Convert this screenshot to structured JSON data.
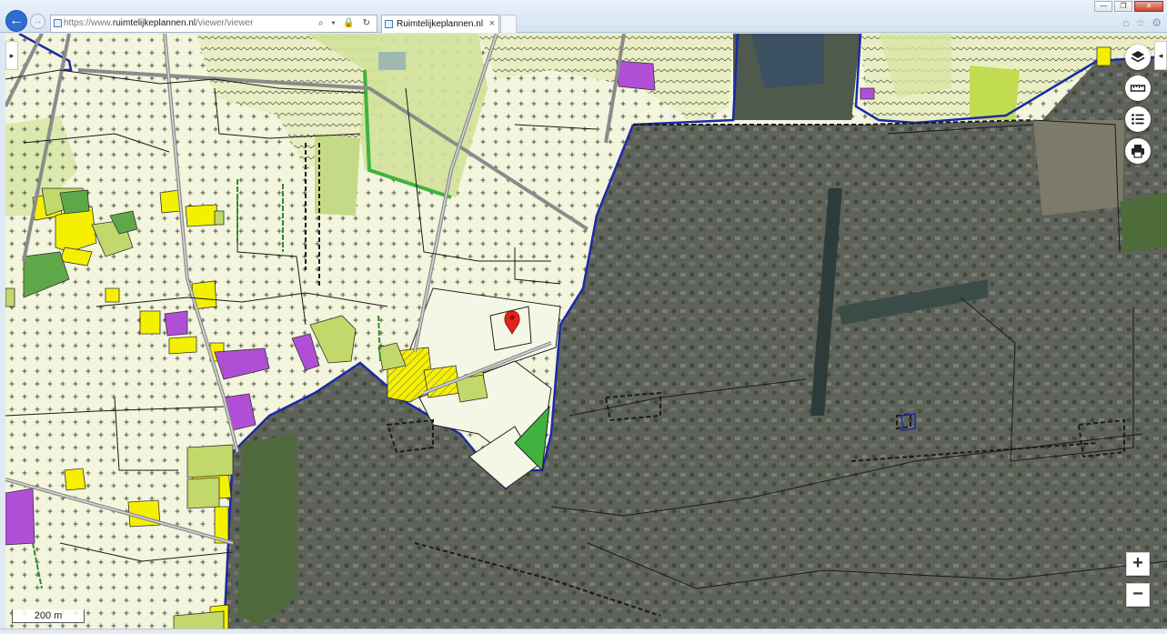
{
  "browser": {
    "url_prefix": "https://www.",
    "url_domain": "ruimtelijkeplannen.nl",
    "url_path": "/viewer/viewer",
    "tab_title": "Ruimtelijkeplannen.nl",
    "tab_close": "×",
    "addr_tools": "⌕ ▾ 🔒 ↻",
    "back_symbol": "←",
    "forward_symbol": "→",
    "window_controls": {
      "minimize": "—",
      "maximize": "❐",
      "close": "✕"
    },
    "toolbar_icons": [
      "home-icon",
      "favorites-star-icon",
      "settings-gear-icon"
    ],
    "toolbar_glyphs": {
      "home": "⌂",
      "favorites": "☆",
      "settings": "⚙"
    }
  },
  "map": {
    "left_panel_toggle": "▸",
    "right_panel_toggle": "◂",
    "tools": [
      "layers-icon",
      "measure-ruler-icon",
      "legend-list-icon",
      "print-icon"
    ],
    "zoom_in": "+",
    "zoom_out": "−",
    "scale_label": "200 m",
    "colors": {
      "agrarisch": "#f3f5dc",
      "natuur_light": "#d7e6a4",
      "natuur": "#bdd476",
      "groen": "#3fb23f",
      "wonen_yellow": "#f5f000",
      "bedrijf_purple": "#b04fd6",
      "plan_boundary": "#1a2aa8",
      "marker": "#e2231a",
      "urban": "#5b5f58"
    }
  }
}
